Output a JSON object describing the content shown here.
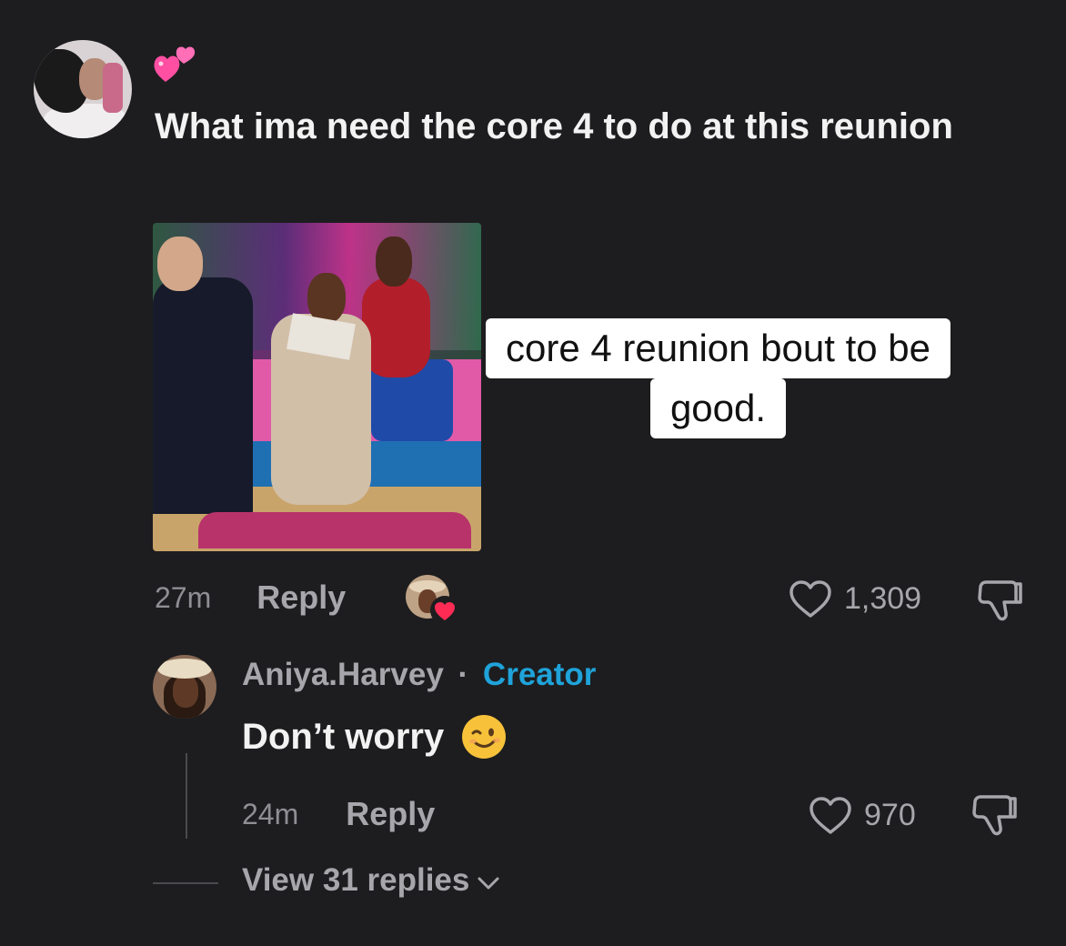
{
  "comment": {
    "emoji_label": "two-hearts",
    "text": "What ima need the core 4 to do at this reunion",
    "caption_line1": "core 4 reunion bout to be",
    "caption_line2": "good.",
    "time": "27m",
    "reply_label": "Reply",
    "likes": "1,309"
  },
  "reply": {
    "username": "Aniya.Harvey",
    "separator": "·",
    "badge": "Creator",
    "text": "Don’t worry",
    "emoji_label": "winking-face",
    "time": "24m",
    "reply_label": "Reply",
    "likes": "970"
  },
  "view_replies": "View 31 replies",
  "colors": {
    "background": "#1d1d1f",
    "creator_badge": "#1fa3da",
    "heart_badge": "#fe2c55"
  }
}
